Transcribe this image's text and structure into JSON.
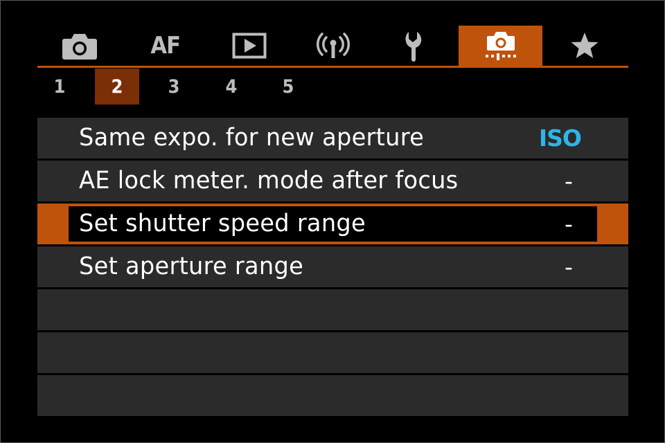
{
  "tabs": [
    {
      "name": "tab-shooting",
      "icon": "camera-icon"
    },
    {
      "name": "tab-af",
      "label": "AF"
    },
    {
      "name": "tab-playback",
      "icon": "play-icon"
    },
    {
      "name": "tab-wireless",
      "icon": "wireless-icon"
    },
    {
      "name": "tab-setup",
      "icon": "wrench-icon"
    },
    {
      "name": "tab-custom-functions",
      "icon": "custom-camera-icon",
      "active": true
    },
    {
      "name": "tab-my-menu",
      "icon": "star-icon"
    }
  ],
  "pages": [
    "1",
    "2",
    "3",
    "4",
    "5"
  ],
  "active_page": "2",
  "menu": {
    "items": [
      {
        "label": "Same expo. for new aperture",
        "value": "ISO"
      },
      {
        "label": "AE lock meter. mode after focus",
        "value": "-"
      },
      {
        "label": "Set shutter speed range",
        "value": "-",
        "selected": true
      },
      {
        "label": "Set aperture range",
        "value": "-"
      }
    ]
  },
  "colors": {
    "accent": "#c0530c",
    "page_active": "#7a2f06",
    "row_bg": "#2b2b2b",
    "value_iso": "#2fb5e6",
    "icon_inactive": "#bdbdbd"
  }
}
